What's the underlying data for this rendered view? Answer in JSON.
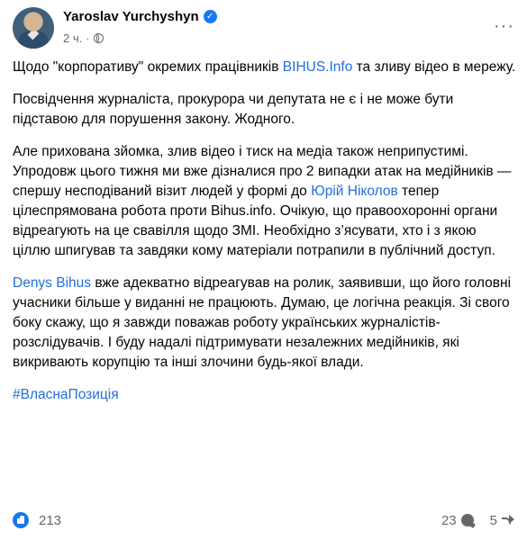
{
  "header": {
    "author": "Yaroslav Yurchyshyn",
    "time": "2 ч.",
    "more_label": "···"
  },
  "post": {
    "p1": {
      "before": "Щодо \"корпоративу\" окремих працівників ",
      "link": "BIHUS.Info",
      "after": " та зливу відео в мережу."
    },
    "p2": "Посвідчення журналіста, прокурора чи депутата не є і не може бути підставою для порушення закону. Жодного.",
    "p3": {
      "before": "Але прихована зйомка, злив відео і тиск на медіа також неприпустимі. Упродовж цього тижня ми вже дізналися про 2 випадки атак на медійників — спершу несподіваний візит людей у формі до ",
      "link": "Юрій Ніколов",
      "after": " тепер цілеспрямована робота проти Bihus.info. Очікую, що правоохоронні органи відреагують на це свавілля щодо ЗМІ. Необхідно з’ясувати, хто і з якою ціллю шпигував та завдяки кому матеріали потрапили в публічний доступ."
    },
    "p4": {
      "link": "Denys Bihus",
      "after": "  вже адекватно відреагував на ролик, заявивши, що його головні учасники більше у виданні не працюють. Думаю, це логічна реакція. Зі свого боку скажу, що я завжди поважав роботу українських журналістів-розслідувачів. І буду надалі підтримувати незалежних медійників, які викривають корупцію та інші злочини будь-якої влади."
    },
    "hashtag": "#ВласнаПозиція"
  },
  "footer": {
    "likes": "213",
    "comments": "23",
    "shares": "5"
  },
  "colors": {
    "link": "#216fdb",
    "accent": "#1877f2",
    "muted": "#65676b"
  },
  "icons": [
    "verified-badge-icon",
    "globe-icon",
    "like-icon",
    "comment-icon",
    "share-icon"
  ]
}
